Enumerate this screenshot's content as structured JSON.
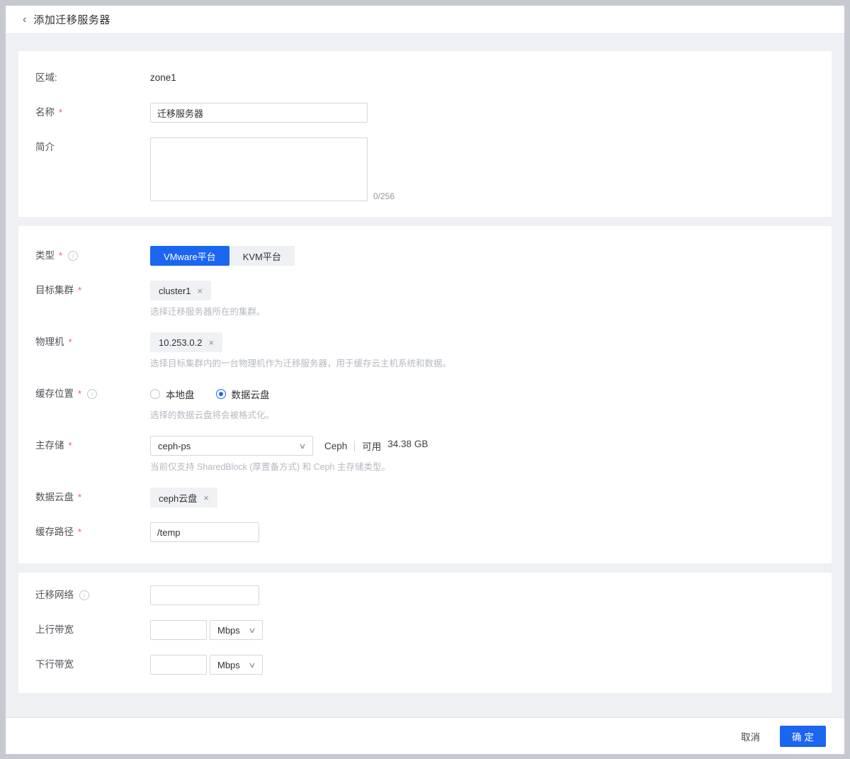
{
  "ui": {
    "back_icon": "‹",
    "required_marker": "*",
    "info_icon": "i",
    "close_icon": "×",
    "chevron_down": "∨",
    "divider": "|"
  },
  "colors": {
    "accent": "#1a66f0",
    "required": "#ff4d6b",
    "tag_bg": "#f0f1f4",
    "page_bg": "#eef0f4"
  },
  "header": {
    "title": "添加迁移服务器"
  },
  "form": {
    "zone": {
      "label": "区域:",
      "value": "zone1"
    },
    "name": {
      "label": "名称",
      "value": "迁移服务器"
    },
    "description": {
      "label": "简介",
      "value": "",
      "counter": "0/256"
    },
    "type": {
      "label": "类型",
      "options": [
        {
          "label": "VMware平台",
          "selected": true
        },
        {
          "label": "KVM平台",
          "selected": false
        }
      ]
    },
    "target_cluster": {
      "label": "目标集群",
      "tag": "cluster1",
      "help": "选择迁移服务器所在的集群。"
    },
    "physical_host": {
      "label": "物理机",
      "tag": "10.253.0.2",
      "help": "选择目标集群内的一台物理机作为迁移服务器，用于缓存云主机系统和数据。"
    },
    "cache_location": {
      "label": "缓存位置",
      "options": [
        {
          "label": "本地盘",
          "selected": false
        },
        {
          "label": "数据云盘",
          "selected": true
        }
      ],
      "help": "选择的数据云盘将会被格式化。"
    },
    "primary_storage": {
      "label": "主存储",
      "value": "ceph-ps",
      "type_text": "Ceph",
      "available_label": "可用",
      "available_value": "34.38 GB",
      "help": "当前仅支持 SharedBlock (厚置备方式) 和 Ceph 主存储类型。"
    },
    "data_volume": {
      "label": "数据云盘",
      "tag": "ceph云盘"
    },
    "cache_path": {
      "label": "缓存路径",
      "value": "/temp"
    },
    "migration_network": {
      "label": "迁移网络",
      "value": ""
    },
    "uplink_bandwidth": {
      "label": "上行带宽",
      "value": "",
      "unit": "Mbps"
    },
    "downlink_bandwidth": {
      "label": "下行带宽",
      "value": "",
      "unit": "Mbps"
    }
  },
  "footer": {
    "cancel": "取消",
    "confirm": "确定"
  }
}
